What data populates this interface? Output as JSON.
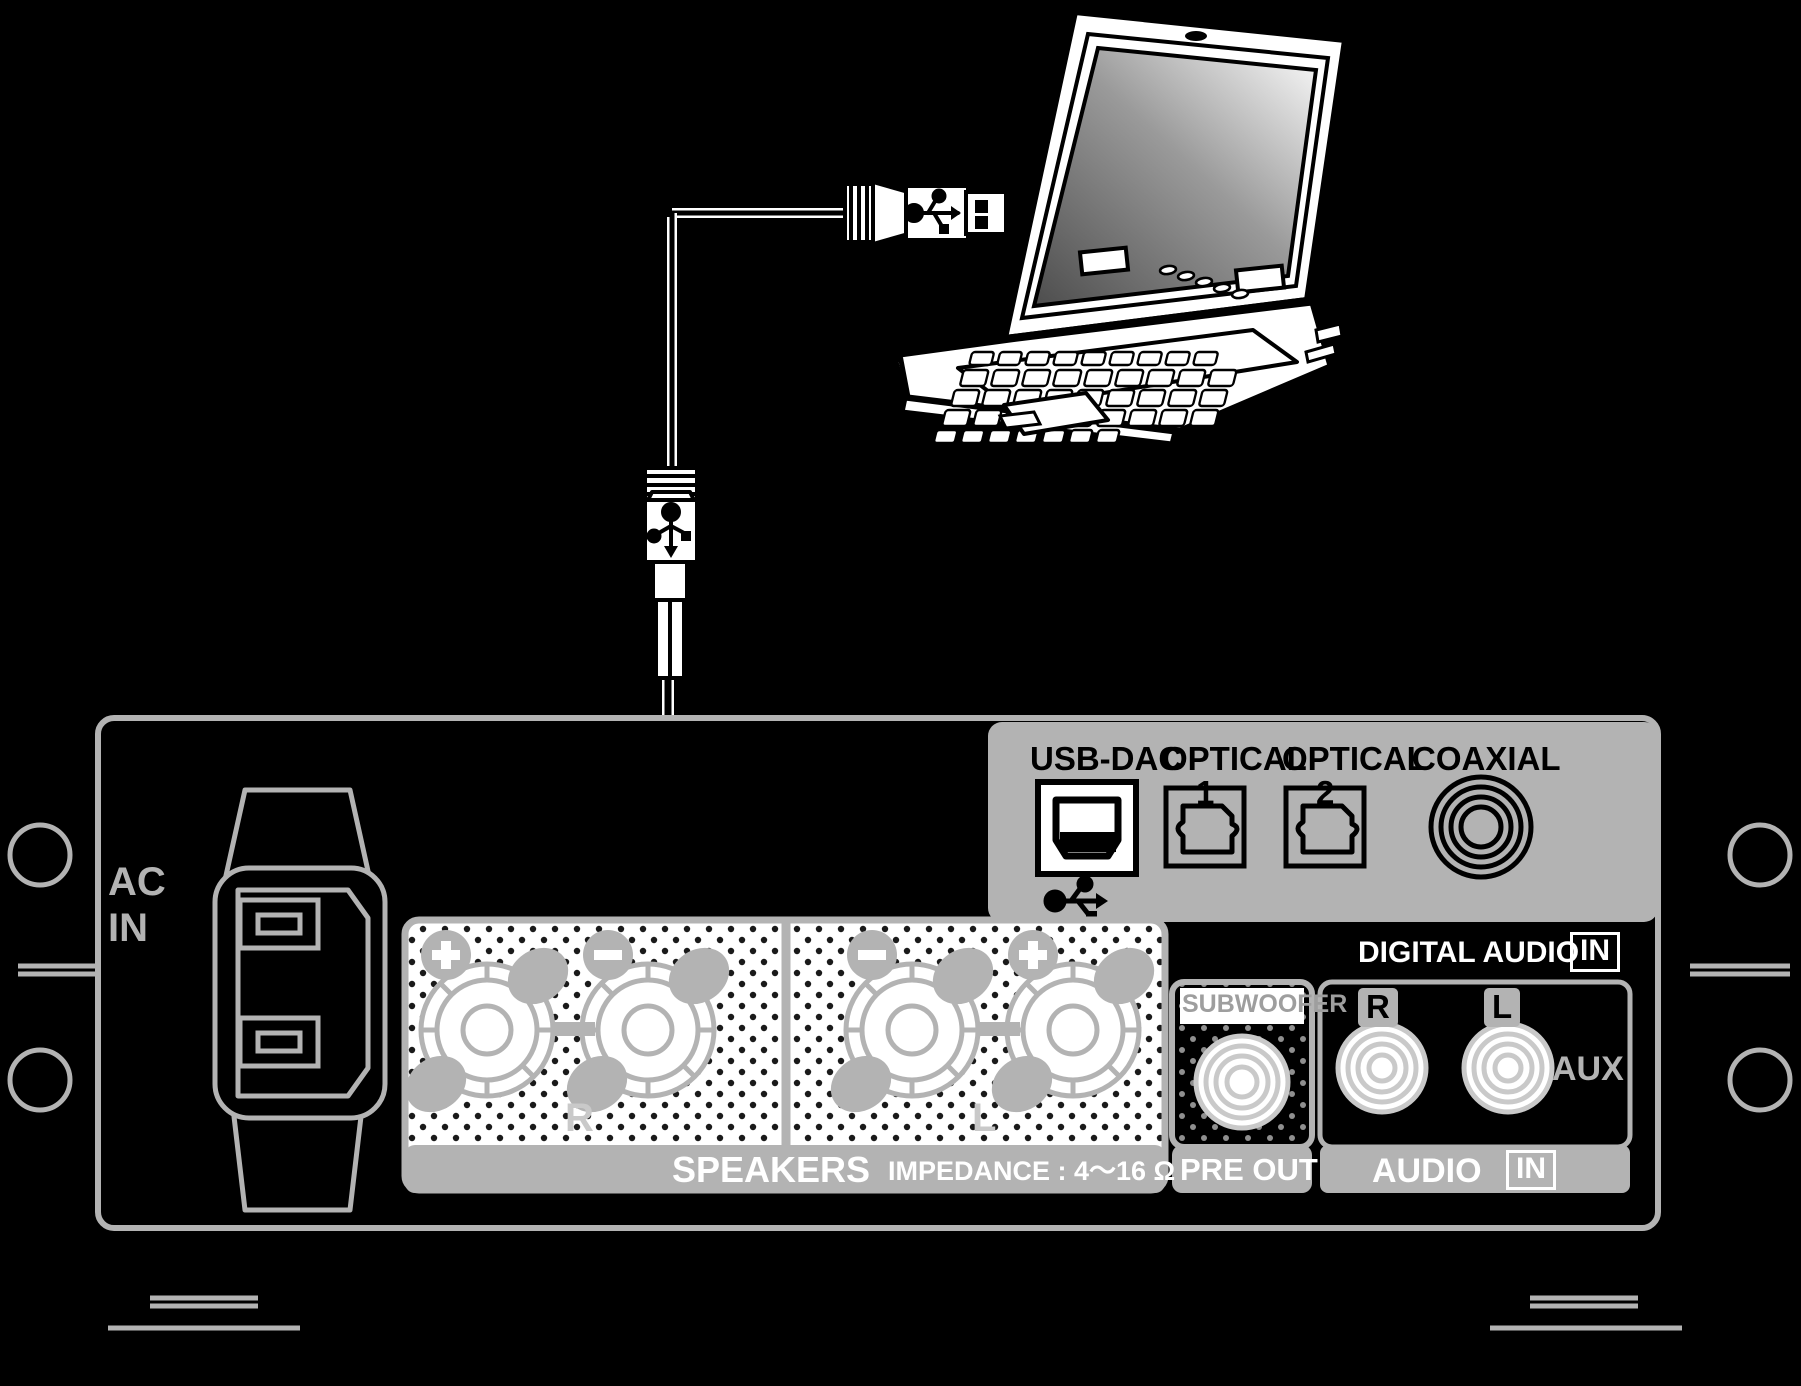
{
  "diagram": {
    "title": "USB-DAC connection diagram",
    "description": "Rear panel of an integrated amplifier connected to a laptop computer via a USB cable into the USB-DAC port",
    "background_color": "#000000"
  },
  "colors": {
    "panel_black": "#000000",
    "panel_gray": "#b3b3b3",
    "outline_gray": "#b3b3b3",
    "white": "#ffffff",
    "screen_dark": "#5a5a5a",
    "screen_light": "#f2f2f2"
  },
  "devices": {
    "laptop": {
      "name": "laptop-computer",
      "screen_label": "",
      "has_trackpad": true,
      "has_keyboard": true
    },
    "amplifier": {
      "name": "amplifier-rear-panel"
    }
  },
  "cable": {
    "name": "usb-cable",
    "type_a_connector": "usb-type-a-connector",
    "type_b_connector": "usb-type-b-connector",
    "logo": "usb-trident-icon"
  },
  "panel": {
    "ac_in": {
      "label_line1": "AC",
      "label_line2": "IN",
      "socket": "iec-power-inlet"
    },
    "digital_section": {
      "ports": [
        {
          "label": "USB-DAC",
          "sub": "",
          "icon": "usb-trident-icon",
          "type": "usb-b-jack"
        },
        {
          "label": "OPTICAL",
          "sub": "1",
          "icon": "toslink-icon",
          "type": "optical-jack"
        },
        {
          "label": "OPTICAL",
          "sub": "2",
          "icon": "toslink-icon",
          "type": "optical-jack"
        },
        {
          "label": "COAXIAL",
          "sub": "",
          "icon": "rca-icon",
          "type": "coaxial-jack"
        }
      ],
      "footer_label": "DIGITAL AUDIO",
      "footer_badge": "IN"
    },
    "speakers": {
      "section_label": "SPEAKERS",
      "impedance_label": "IMPEDANCE : 4〜16 Ω",
      "channels": [
        {
          "name": "R",
          "plus": "+",
          "minus": "−"
        },
        {
          "name": "L",
          "plus": "+",
          "minus": "−"
        }
      ]
    },
    "pre_out": {
      "jack_label": "SUBWOOFER",
      "section_label": "PRE OUT"
    },
    "audio_in": {
      "jacks": [
        {
          "label": "R"
        },
        {
          "label": "L"
        }
      ],
      "source_label": "AUX",
      "section_label": "AUDIO",
      "section_badge": "IN"
    }
  }
}
